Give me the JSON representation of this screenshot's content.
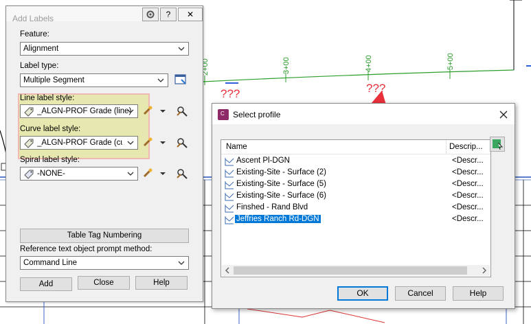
{
  "drawing": {
    "stations": [
      "2+00",
      "3+00",
      "4+00",
      "5+00"
    ],
    "unknown_marks": [
      "???",
      "???"
    ],
    "annotation_color": "#e8303a",
    "alignment_color": "#2a9d2a"
  },
  "add_labels": {
    "title": "Add Labels",
    "title_buttons": {
      "settings": "⚙",
      "help": "?",
      "close": "✕"
    },
    "feature": {
      "label": "Feature:",
      "value": "Alignment"
    },
    "label_type": {
      "label": "Label type:",
      "value": "Multiple Segment"
    },
    "line_label_style": {
      "label": "Line label style:",
      "value": "_ALGN-PROF Grade (line)"
    },
    "curve_label_style": {
      "label": "Curve label style:",
      "value": "_ALGN-PROF Grade (curv"
    },
    "spiral_label_style": {
      "label": "Spiral label style:",
      "value": "-NONE-"
    },
    "table_tag_button": "Table Tag Numbering",
    "reference_prompt": {
      "label": "Reference text object prompt method:",
      "value": "Command Line"
    },
    "buttons": {
      "add": "Add",
      "close": "Close",
      "help": "Help"
    },
    "highlight_color": "#f1b7b2"
  },
  "select_profile": {
    "title": "Select profile",
    "app_icon_text": "C",
    "columns": {
      "name": "Name",
      "description": "Descrip..."
    },
    "rows": [
      {
        "name": "Ascent Pl-DGN",
        "description": "<Descr..."
      },
      {
        "name": "Existing-Site - Surface (2)",
        "description": "<Descr..."
      },
      {
        "name": "Existing-Site - Surface (5)",
        "description": "<Descr..."
      },
      {
        "name": "Existing-Site - Surface (6)",
        "description": "<Descr..."
      },
      {
        "name": "Finshed - Rand Blvd",
        "description": "<Descr..."
      },
      {
        "name": "Jeffries Ranch Rd-DGN",
        "description": "<Descr..."
      }
    ],
    "selected_row": "Jeffries Ranch Rd-DGN",
    "buttons": {
      "ok": "OK",
      "cancel": "Cancel",
      "help": "Help"
    },
    "selection_color": "#0078d7"
  }
}
